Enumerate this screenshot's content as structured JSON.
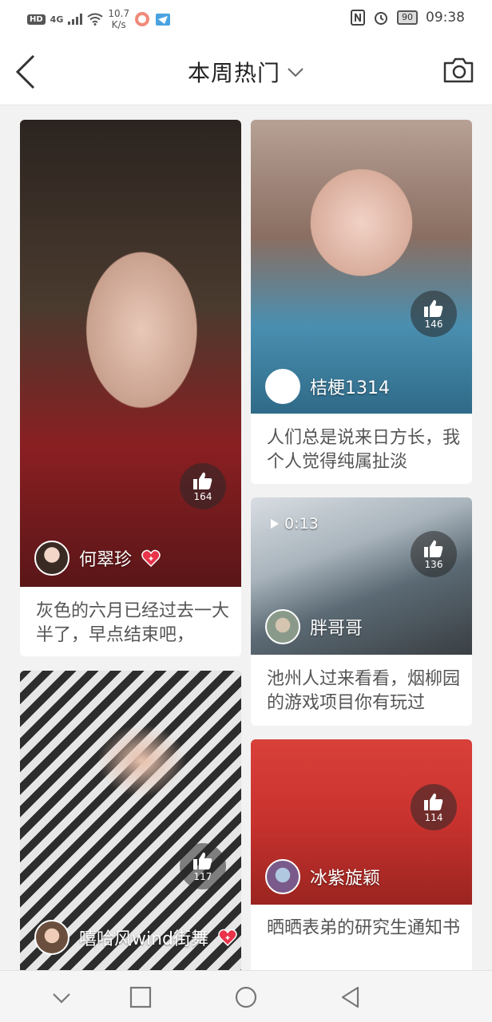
{
  "status_bar": {
    "hd": "HD",
    "signal": "4G",
    "speed_value": "10.7",
    "speed_unit": "K/s",
    "battery": "90",
    "time": "09:38"
  },
  "header": {
    "title": "本周热门"
  },
  "posts": [
    {
      "username": "何翠珍",
      "caption": "灰色的六月已经过去一大半了，早点结束吧，",
      "likes": "164",
      "liked": true
    },
    {
      "username": "桔梗1314",
      "caption": "人们总是说来日方长，我个人觉得纯属扯淡",
      "likes": "146",
      "liked": false
    },
    {
      "username": "胖哥哥",
      "caption": "池州人过来看看，烟柳园的游戏项目你有玩过",
      "likes": "136",
      "liked": false,
      "video_duration": "0:13"
    },
    {
      "username": "嘻哈风wind街舞",
      "caption": "",
      "likes": "117",
      "liked": true
    },
    {
      "username": "冰紫旋颖",
      "caption": "晒晒表弟的研究生通知书",
      "likes": "114",
      "liked": false
    }
  ],
  "colors": {
    "heart": "#e8334a",
    "background": "#f2f2f2"
  }
}
